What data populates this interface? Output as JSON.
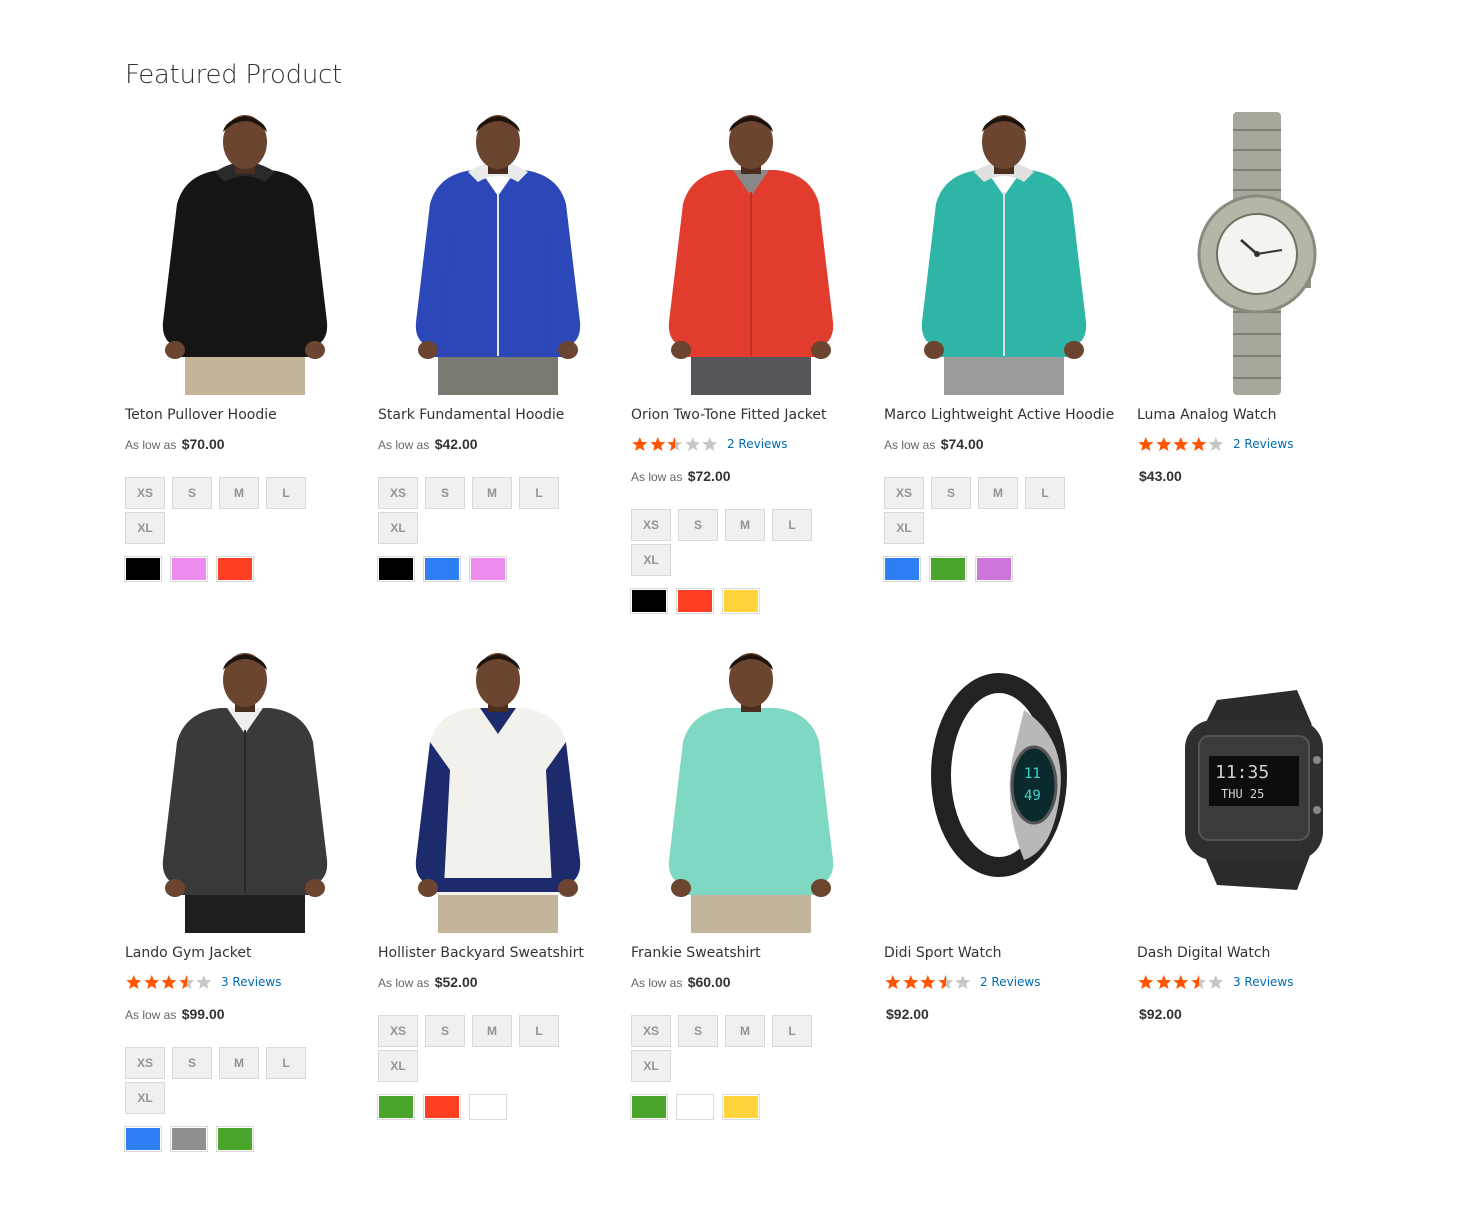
{
  "section": {
    "title": "Featured Product"
  },
  "colors": {
    "star_on": "#ff5501",
    "star_off": "#c7c7c7",
    "link": "#006bb4"
  },
  "products": [
    {
      "name": "Teton Pullover Hoodie",
      "price_label": "As low as",
      "price": "$70.00",
      "sizes": [
        "XS",
        "S",
        "M",
        "L",
        "XL"
      ],
      "swatches": [
        "#000000",
        "#ef8cef",
        "#ff4022"
      ],
      "image": "man-black-hoodie"
    },
    {
      "name": "Stark Fundamental Hoodie",
      "price_label": "As low as",
      "price": "$42.00",
      "sizes": [
        "XS",
        "S",
        "M",
        "L",
        "XL"
      ],
      "swatches": [
        "#000000",
        "#2e7ff5",
        "#ef8cef"
      ],
      "image": "man-blue-hoodie"
    },
    {
      "name": "Orion Two-Tone Fitted Jacket",
      "rating": 2.5,
      "reviews": "2 Reviews",
      "price_label": "As low as",
      "price": "$72.00",
      "sizes": [
        "XS",
        "S",
        "M",
        "L",
        "XL"
      ],
      "swatches": [
        "#000000",
        "#ff4022",
        "#ffd43b"
      ],
      "image": "man-red-jacket"
    },
    {
      "name": "Marco Lightweight Active Hoodie",
      "price_label": "As low as",
      "price": "$74.00",
      "sizes": [
        "XS",
        "S",
        "M",
        "L",
        "XL"
      ],
      "swatches": [
        "#2e7ff5",
        "#4aa52a",
        "#cf74d8"
      ],
      "image": "man-teal-hoodie"
    },
    {
      "name": "Luma Analog Watch",
      "rating": 4,
      "reviews": "2 Reviews",
      "price": "$43.00",
      "image": "analog-watch"
    },
    {
      "name": "Lando Gym Jacket",
      "rating": 3.5,
      "reviews": "3 Reviews",
      "price_label": "As low as",
      "price": "$99.00",
      "sizes": [
        "XS",
        "S",
        "M",
        "L",
        "XL"
      ],
      "swatches": [
        "#2e7ff5",
        "#8f8f8f",
        "#4aa52a"
      ],
      "image": "man-gray-jacket"
    },
    {
      "name": "Hollister Backyard Sweatshirt",
      "price_label": "As low as",
      "price": "$52.00",
      "sizes": [
        "XS",
        "S",
        "M",
        "L",
        "XL"
      ],
      "swatches": [
        "#4aa52a",
        "#ff4022",
        "#ffffff"
      ],
      "image": "man-raglan-sweatshirt"
    },
    {
      "name": "Frankie Sweatshirt",
      "price_label": "As low as",
      "price": "$60.00",
      "sizes": [
        "XS",
        "S",
        "M",
        "L",
        "XL"
      ],
      "swatches": [
        "#4aa52a",
        "#ffffff",
        "#ffd43b"
      ],
      "image": "man-mint-sweatshirt"
    },
    {
      "name": "Didi Sport Watch",
      "rating": 3.5,
      "reviews": "2 Reviews",
      "price": "$92.00",
      "image": "sport-watch"
    },
    {
      "name": "Dash Digital Watch",
      "rating": 3.5,
      "reviews": "3 Reviews",
      "price": "$92.00",
      "image": "digital-watch"
    }
  ]
}
